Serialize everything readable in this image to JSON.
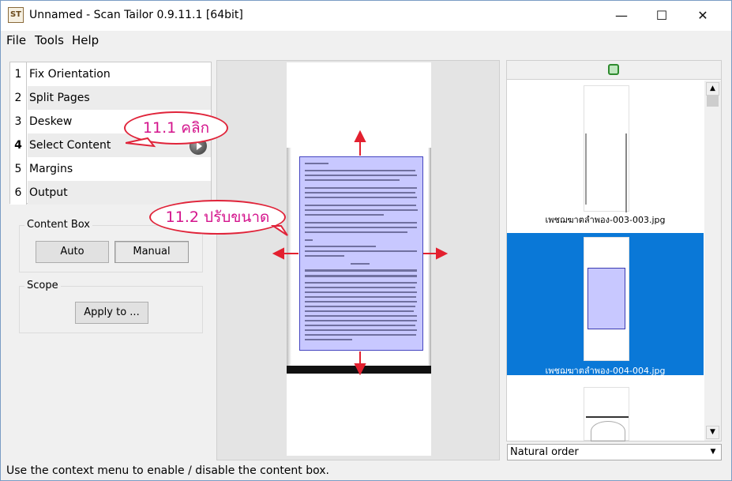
{
  "window": {
    "title": "Unnamed - Scan Tailor 0.9.11.1 [64bit]",
    "icon": "app-icon",
    "icon_text": "ST",
    "controls": {
      "minimize": "—",
      "maximize": "☐",
      "close": "✕"
    }
  },
  "menu": [
    "File",
    "Tools",
    "Help"
  ],
  "stages": [
    {
      "num": "1",
      "label": "Fix Orientation"
    },
    {
      "num": "2",
      "label": "Split Pages"
    },
    {
      "num": "3",
      "label": "Deskew"
    },
    {
      "num": "4",
      "label": "Select Content",
      "active": true
    },
    {
      "num": "5",
      "label": "Margins"
    },
    {
      "num": "6",
      "label": "Output"
    }
  ],
  "content_box": {
    "title": "Content Box",
    "auto": "Auto",
    "manual": "Manual",
    "selected": "Manual"
  },
  "scope": {
    "title": "Scope",
    "apply": "Apply to ..."
  },
  "annotations": {
    "click": "11.1 คลิก",
    "resize": "11.2 ปรับขนาด"
  },
  "thumbnails": [
    {
      "name": "เพชฌฆาตลำพอง-003-003.jpg",
      "selected": false
    },
    {
      "name": "เพชฌฆาตลำพอง-004-004.jpg",
      "selected": true
    }
  ],
  "sort_order": "Natural order",
  "status": "Use the context menu to enable / disable the content box.",
  "colors": {
    "accent": "#0a78d7",
    "annotation_border": "#e0243a",
    "annotation_text": "#d4148c",
    "content_box": "#bebeff"
  }
}
